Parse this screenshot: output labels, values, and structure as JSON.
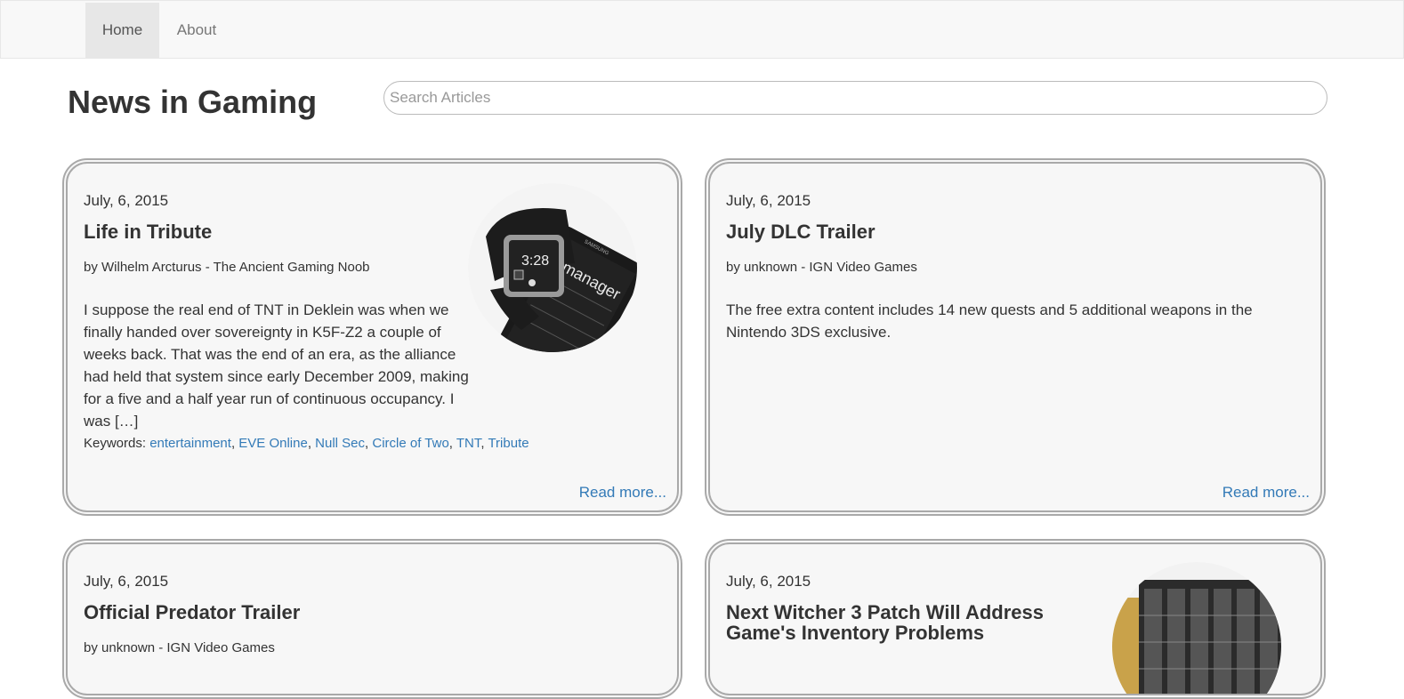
{
  "nav": {
    "home": "Home",
    "about": "About"
  },
  "page_title": "News in Gaming",
  "search": {
    "placeholder": "Search Articles",
    "value": ""
  },
  "articles": [
    {
      "date": "July, 6, 2015",
      "title": "Life in Tribute",
      "byline": "by Wilhelm Arcturus - The Ancient Gaming Noob",
      "excerpt": "I suppose the real end of TNT in Deklein was when we finally handed over sovereignty in K5F-Z2 a couple of weeks back. That was the end of an era, as the alliance had held that system since early December 2009, making for a five and a half year run of continuous occupancy.  I was […]",
      "keywords_label": "Keywords:",
      "keywords": [
        "entertainment",
        "EVE Online",
        "Null Sec",
        "Circle of Two",
        "TNT",
        "Tribute"
      ],
      "read_more": "Read more...",
      "image_icon": "smartwatch-photo",
      "image_text": {
        "time": "3:28",
        "brand": "SAMSUNG",
        "app": "manager"
      }
    },
    {
      "date": "July, 6, 2015",
      "title": "July DLC Trailer",
      "byline": "by unknown - IGN Video Games",
      "excerpt": "The free extra content includes 14 new quests and 5 additional weapons in the Nintendo 3DS exclusive.",
      "read_more": "Read more..."
    },
    {
      "date": "July, 6, 2015",
      "title": "Official Predator Trailer",
      "byline": "by unknown - IGN Video Games"
    },
    {
      "date": "July, 6, 2015",
      "title": "Next Witcher 3 Patch Will Address Game's Inventory Problems",
      "image_icon": "server-rack-photo"
    }
  ],
  "colors": {
    "link": "#337ab7",
    "card_bg": "#f7f7f7",
    "card_border": "#a9a9a9",
    "nav_bg": "#f8f8f8",
    "nav_active": "#e7e7e7"
  }
}
